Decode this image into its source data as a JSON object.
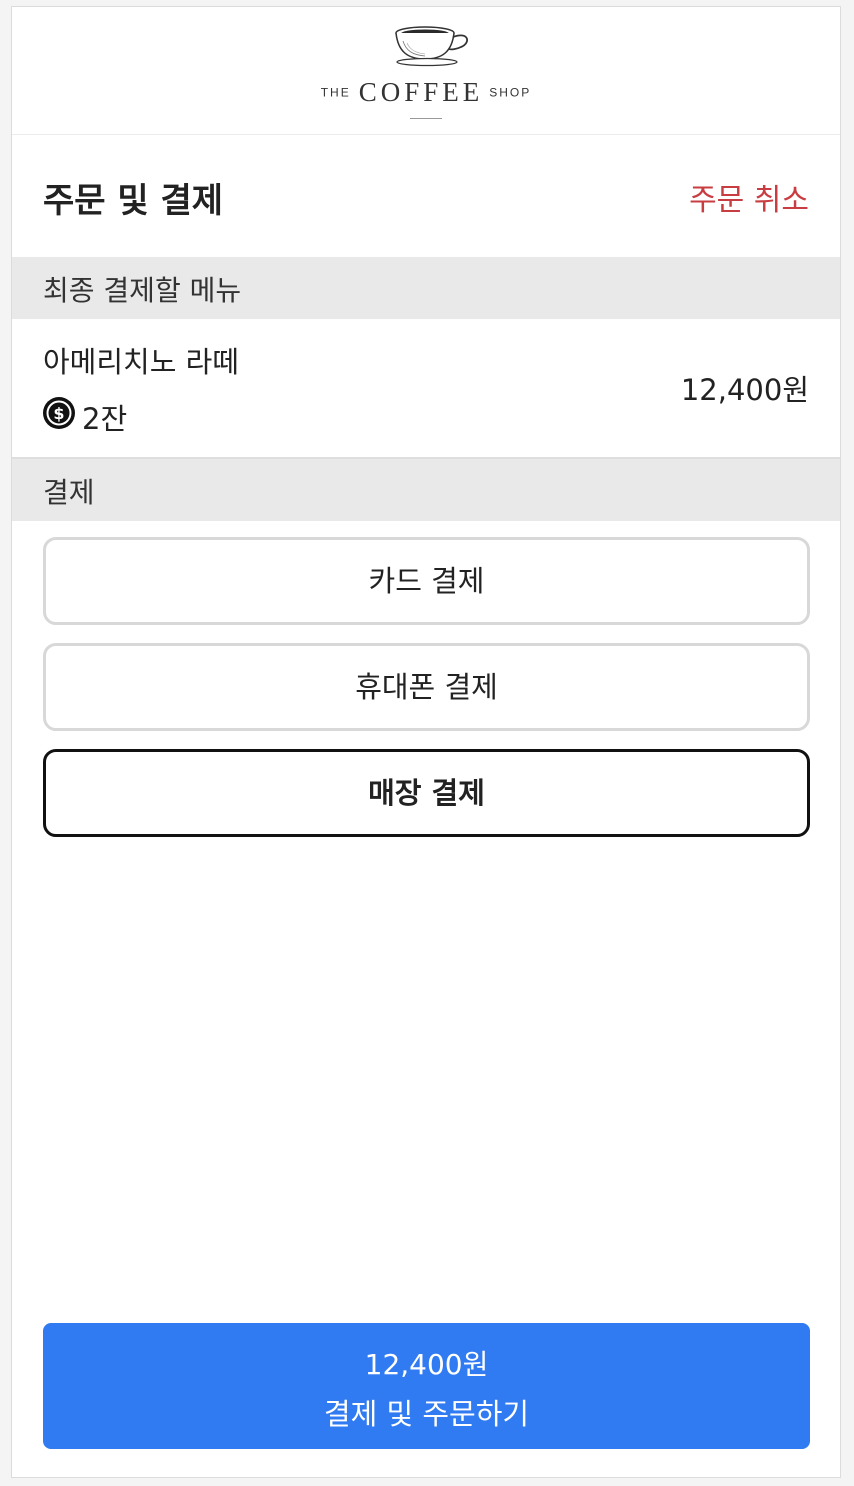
{
  "header": {
    "logo": {
      "prefix": "THE",
      "name": "COFFEE",
      "suffix": "SHOP",
      "icon": "coffee-cup-icon"
    }
  },
  "title_row": {
    "title": "주문 및 결제",
    "cancel_label": "주문 취소",
    "cancel_color": "#c83d42"
  },
  "order": {
    "section_label": "최종 결제할 메뉴",
    "items": [
      {
        "name": "아메리치노 라떼",
        "quantity": "2잔",
        "quantity_icon": "coin-icon",
        "price": "12,400원"
      }
    ]
  },
  "payment": {
    "section_label": "결제",
    "methods": [
      {
        "label": "카드 결제",
        "selected": false
      },
      {
        "label": "휴대폰 결제",
        "selected": false
      },
      {
        "label": "매장 결제",
        "selected": true
      }
    ]
  },
  "submit": {
    "price": "12,400원",
    "label": "결제 및 주문하기",
    "color": "#307bf2"
  }
}
